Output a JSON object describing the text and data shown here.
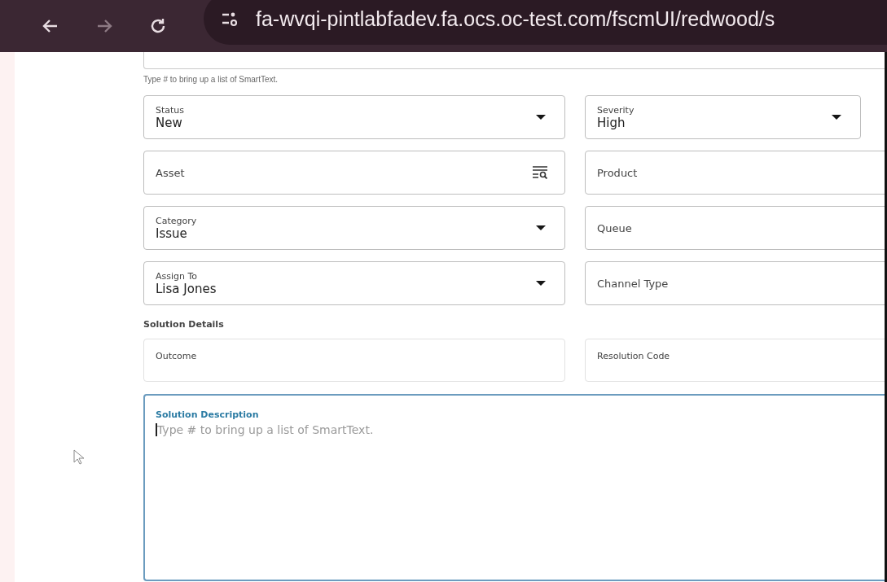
{
  "browser": {
    "back": {
      "disabled": false
    },
    "forward": {
      "disabled": true
    },
    "url": "fa-wvqi-pintlabfadev.fa.ocs.oc-test.com/fscmUI/redwood/s"
  },
  "top_field": {
    "helper": "Type # to bring up a list of SmartText."
  },
  "rows": [
    [
      {
        "kind": "select",
        "label": "Status",
        "value": "New"
      },
      {
        "kind": "select",
        "label": "Severity",
        "value": "High"
      }
    ],
    [
      {
        "kind": "lookup",
        "label": "Asset"
      },
      {
        "kind": "text",
        "label": "Product"
      }
    ],
    [
      {
        "kind": "select",
        "label": "Category",
        "value": "Issue"
      },
      {
        "kind": "text",
        "label": "Queue"
      }
    ],
    [
      {
        "kind": "select",
        "label": "Assign To",
        "value": "Lisa Jones"
      },
      {
        "kind": "text",
        "label": "Channel Type"
      }
    ]
  ],
  "solution": {
    "heading": "Solution Details",
    "fields": [
      {
        "label": "Outcome"
      },
      {
        "label": "Resolution Code"
      }
    ],
    "description": {
      "label": "Solution Description",
      "placeholder": "Type # to bring up a list of SmartText.",
      "focused": true
    }
  }
}
